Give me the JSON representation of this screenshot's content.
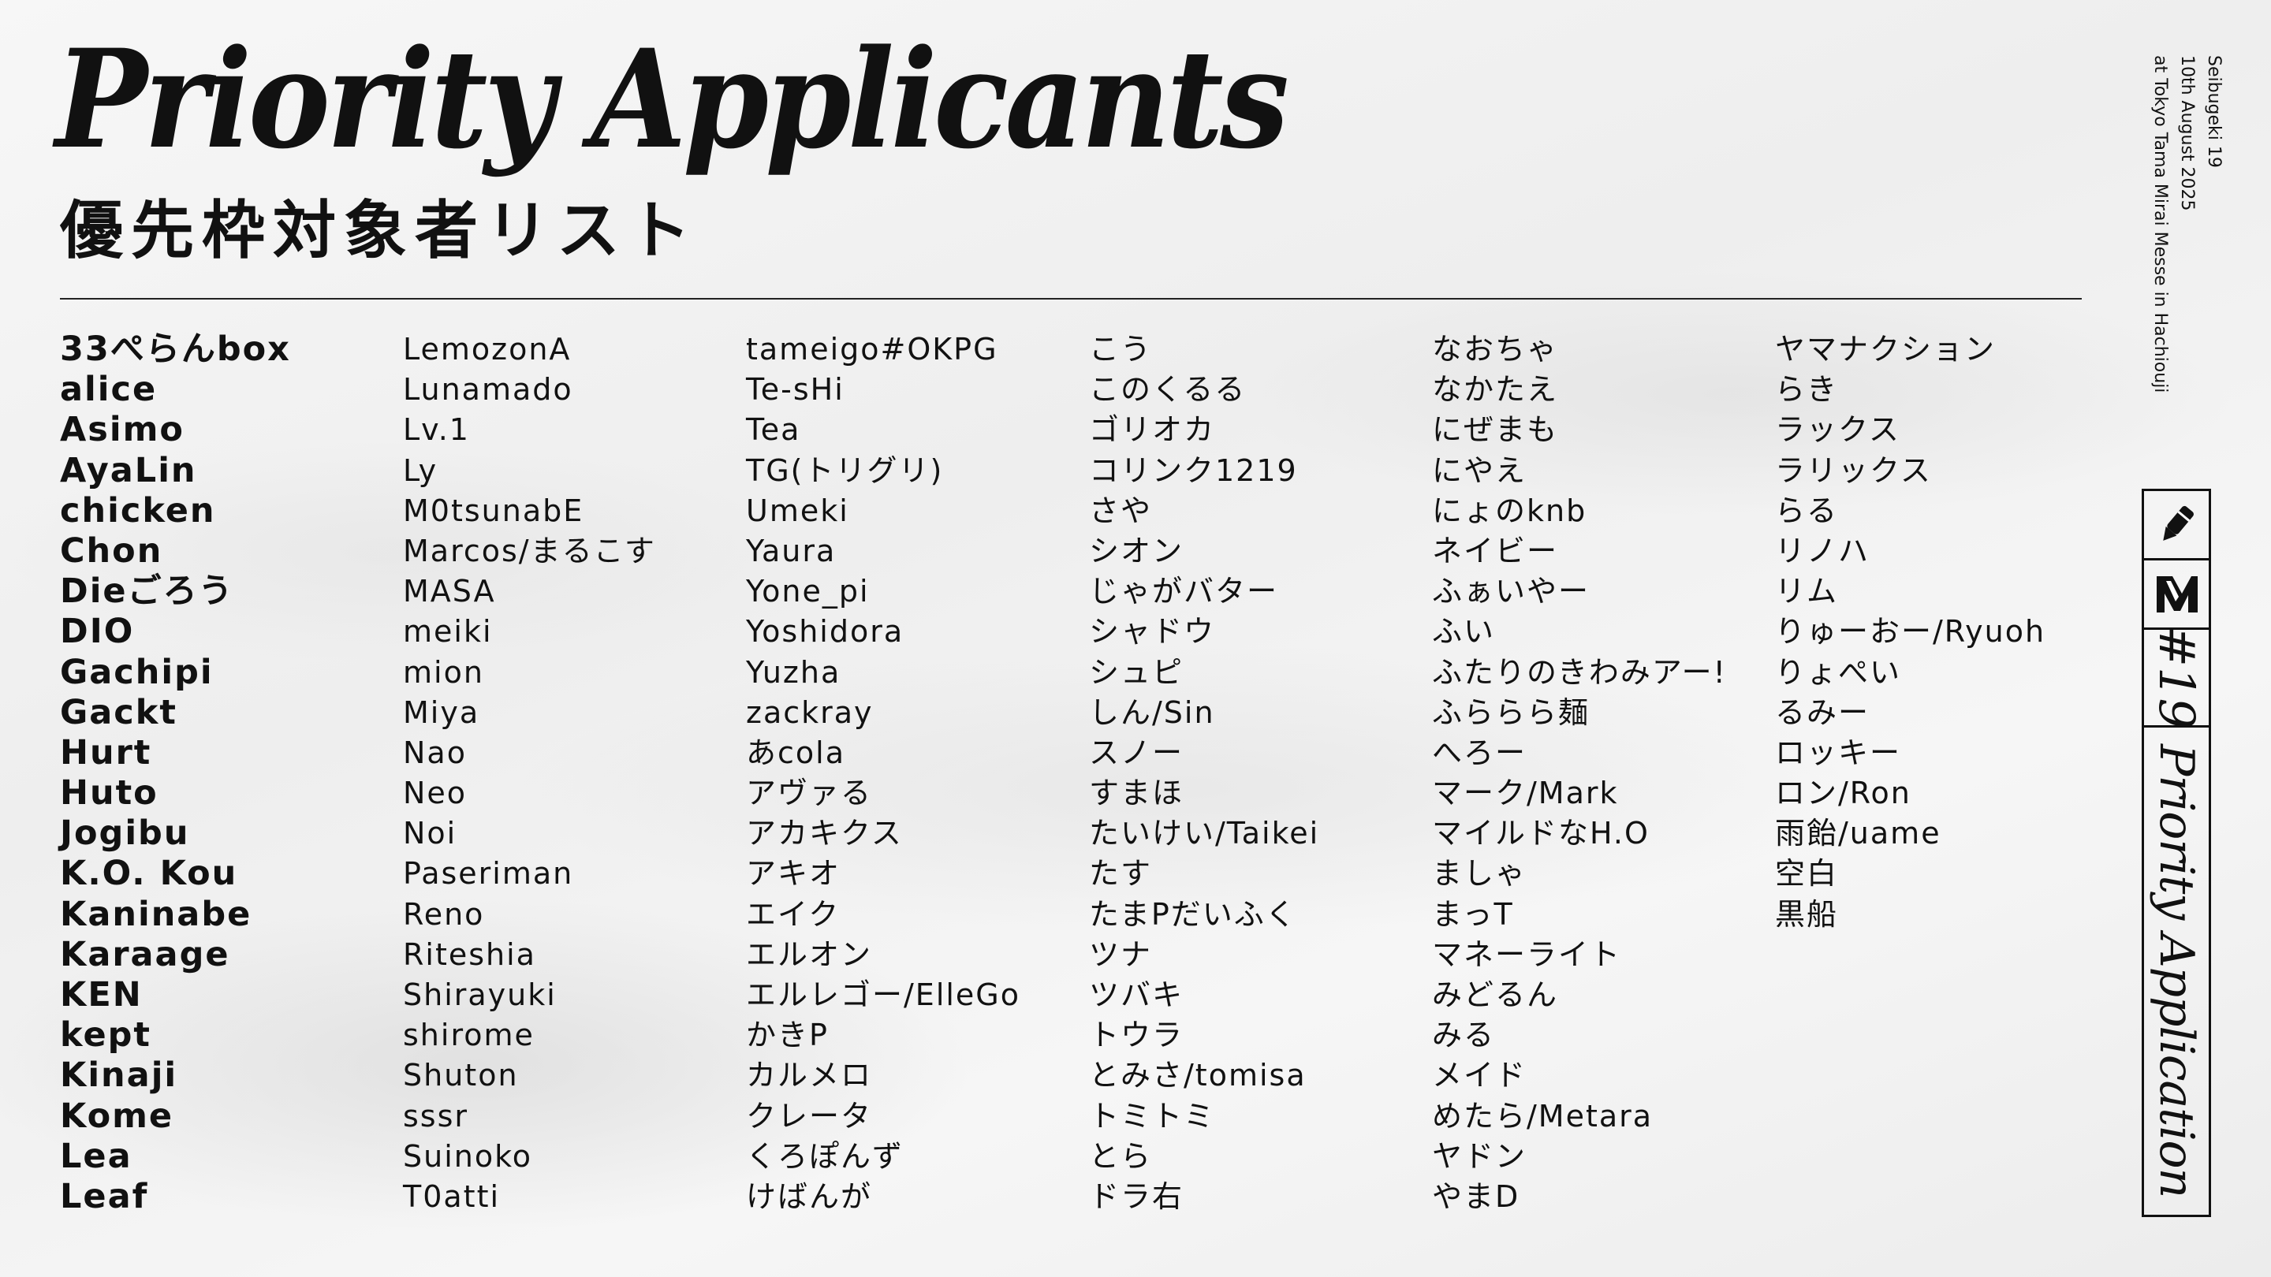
{
  "title": "Priority Applicants",
  "subtitle": "優先枠対象者リスト",
  "event": {
    "name": "Seibugeki 19",
    "date": "10th August 2025",
    "venue": "at Tokyo Tama Mirai Messe in Hachiouji"
  },
  "badge": {
    "number": "#19",
    "label": "Priority Application"
  },
  "columns": [
    [
      "33ぺらんbox",
      "alice",
      "Asimo",
      "AyaLin",
      "chicken",
      "Chon",
      "Dieごろう",
      "DIO",
      "Gachipi",
      "Gackt",
      "Hurt",
      "Huto",
      "Jogibu",
      "K.O. Kou",
      "Kaninabe",
      "Karaage",
      "KEN",
      "kept",
      "Kinaji",
      "Kome",
      "Lea",
      "Leaf"
    ],
    [
      "LemozonA",
      "Lunamado",
      "Lv.1",
      "Ly",
      "M0tsunabE",
      "Marcos/まるこす",
      "MASA",
      "meiki",
      "mion",
      "Miya",
      "Nao",
      "Neo",
      "Noi",
      "Paseriman",
      "Reno",
      "Riteshia",
      "Shirayuki",
      "shirome",
      "Shuton",
      "sssr",
      "Suinoko",
      "T0atti"
    ],
    [
      "tameigo#OKPG",
      "Te-sHi",
      "Tea",
      "TG(トリグリ)",
      "Umeki",
      "Yaura",
      "Yone_pi",
      "Yoshidora",
      "Yuzha",
      "zackray",
      "あcola",
      "アヴァる",
      "アカキクス",
      "アキオ",
      "エイク",
      "エルオン",
      "エルレゴー/ElleGo",
      "かきP",
      "カルメロ",
      "クレータ",
      "くろぽんず",
      "けばんが"
    ],
    [
      "こう",
      "このくるる",
      "ゴリオカ",
      "コリンク1219",
      "さや",
      "シオン",
      "じゃがバター",
      "シャドウ",
      "シュピ",
      "しん/Sin",
      "スノー",
      "すまほ",
      "たいけい/Taikei",
      "たす",
      "たまPだいふく",
      "ツナ",
      "ツバキ",
      "トウラ",
      "とみさ/tomisa",
      "トミトミ",
      "とら",
      "ドラ右"
    ],
    [
      "なおちゃ",
      "なかたえ",
      "にぜまも",
      "にやえ",
      "にょのknb",
      "ネイビー",
      "ふぁいやー",
      "ふい",
      "ふたりのきわみアー!",
      "ふららら麺",
      "へろー",
      "マーク/Mark",
      "マイルドなH.O",
      "ましゃ",
      "まっT",
      "マネーライト",
      "みどるん",
      "みる",
      "メイド",
      "めたら/Metara",
      "ヤドン",
      "やまD"
    ],
    [
      "ヤマナクション",
      "らき",
      "ラックス",
      "ラリックス",
      "らる",
      "リノハ",
      "リム",
      "りゅーおー/Ryuoh",
      "りょぺい",
      "るみー",
      "ロッキー",
      "ロン/Ron",
      "雨飴/uame",
      "空白",
      "黒船"
    ]
  ]
}
